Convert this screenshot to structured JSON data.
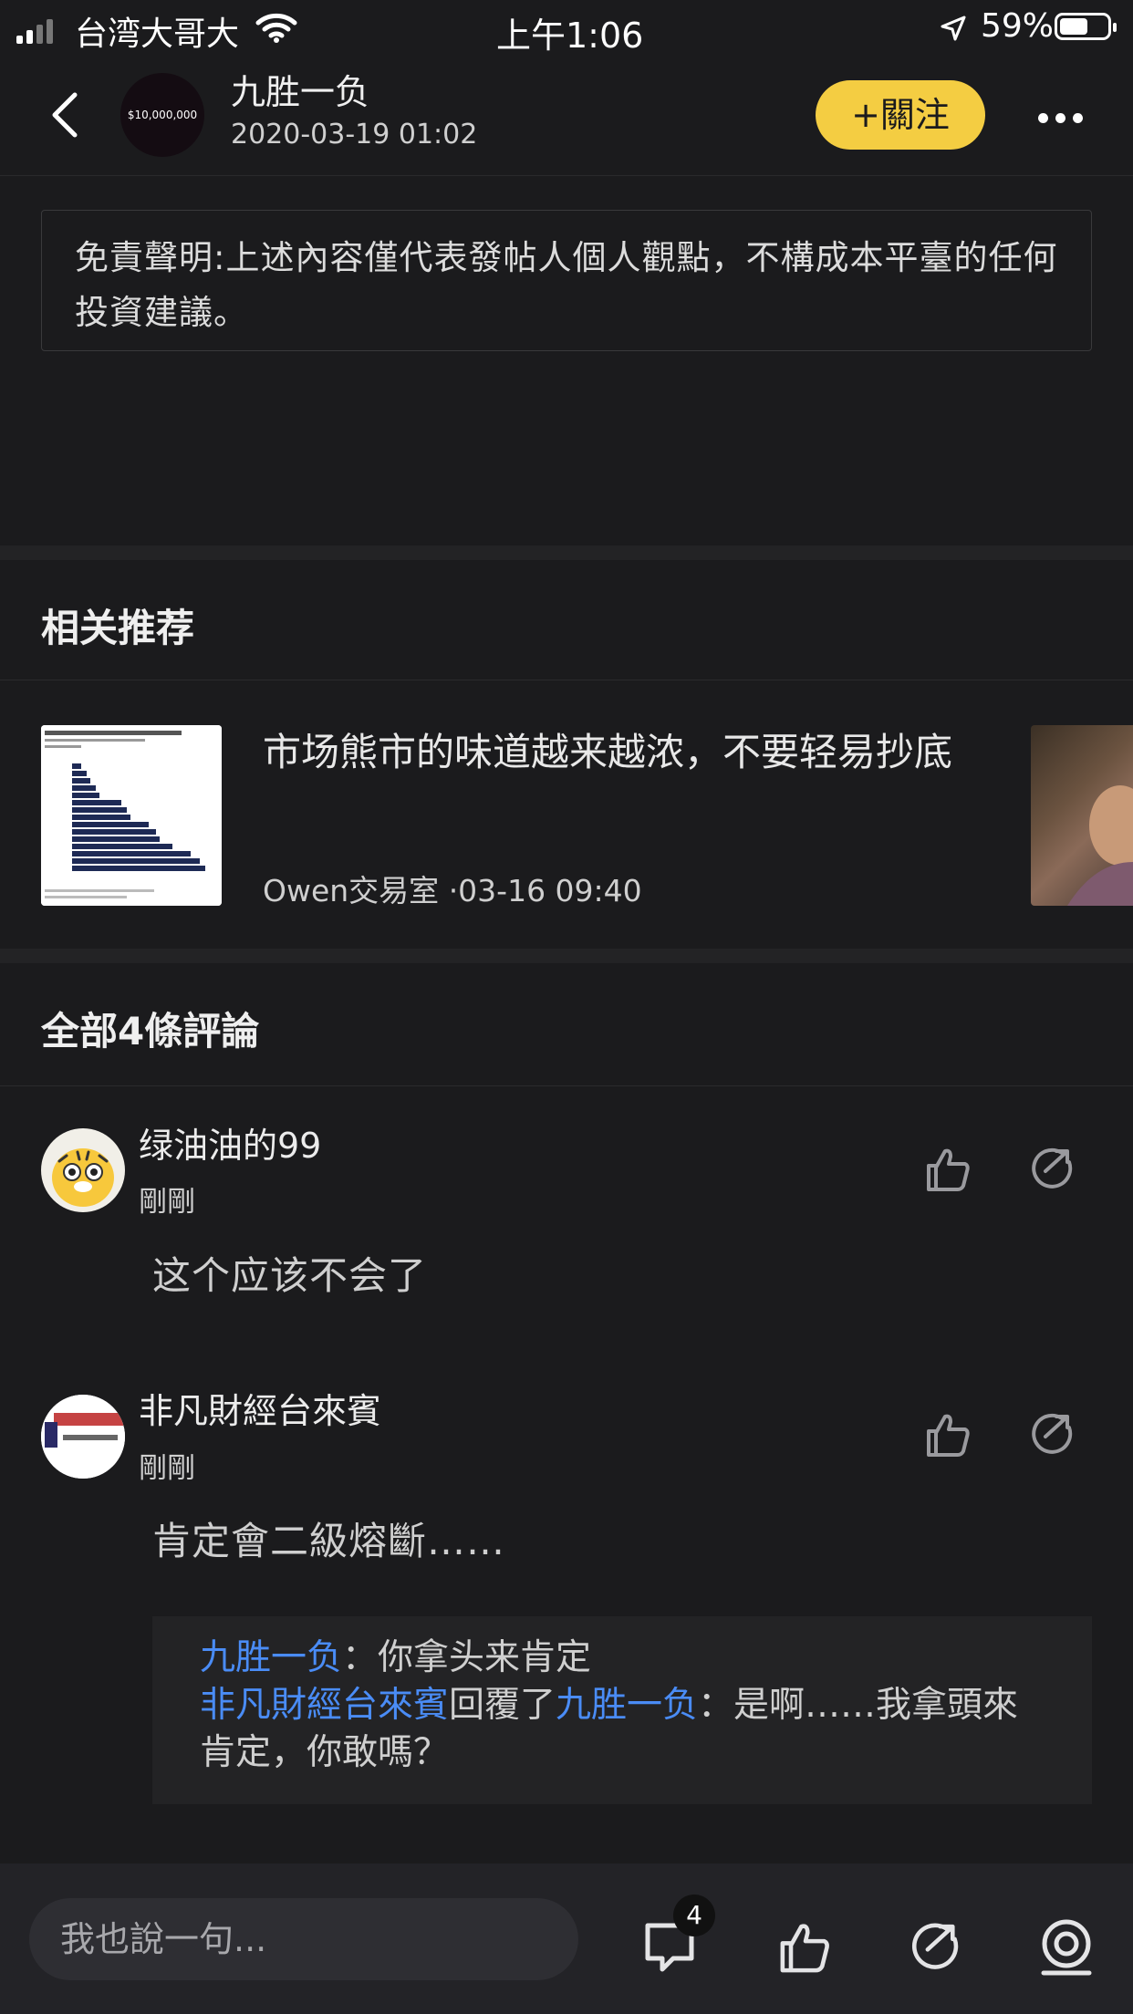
{
  "status_bar": {
    "carrier": "台湾大哥大",
    "time": "上午1:06",
    "battery": "59%"
  },
  "header": {
    "avatar_text": "$10,000,000",
    "author": "九胜一负",
    "timestamp": "2020-03-19 01:02",
    "follow_label": "+關注"
  },
  "disclaimer": "免責聲明:上述內容僅代表發帖人個人觀點，不構成本平臺的任何投資建議。",
  "recommend": {
    "section_title": "相关推荐",
    "item": {
      "title": "市场熊市的味道越来越浓，不要轻易抄底",
      "author": "Owen交易室",
      "time": "·03-16 09:40"
    }
  },
  "comments": {
    "section_title": "全部4條評論",
    "items": [
      {
        "name": "绿油油的99",
        "time": "剛剛",
        "text": "这个应该不会了"
      },
      {
        "name": "非凡財經台來賓",
        "time": "剛剛",
        "text": "肯定會二級熔斷……"
      }
    ],
    "replies": [
      {
        "user": "九胜一负",
        "text": "：你拿头来肯定"
      },
      {
        "user": "非凡財經台來賓",
        "verb": "回覆了",
        "target": "九胜一负",
        "text": "：是啊……我拿頭來肯定，你敢嗎？"
      }
    ]
  },
  "bottom_bar": {
    "input_placeholder": "我也說一句...",
    "comment_count": "4"
  }
}
